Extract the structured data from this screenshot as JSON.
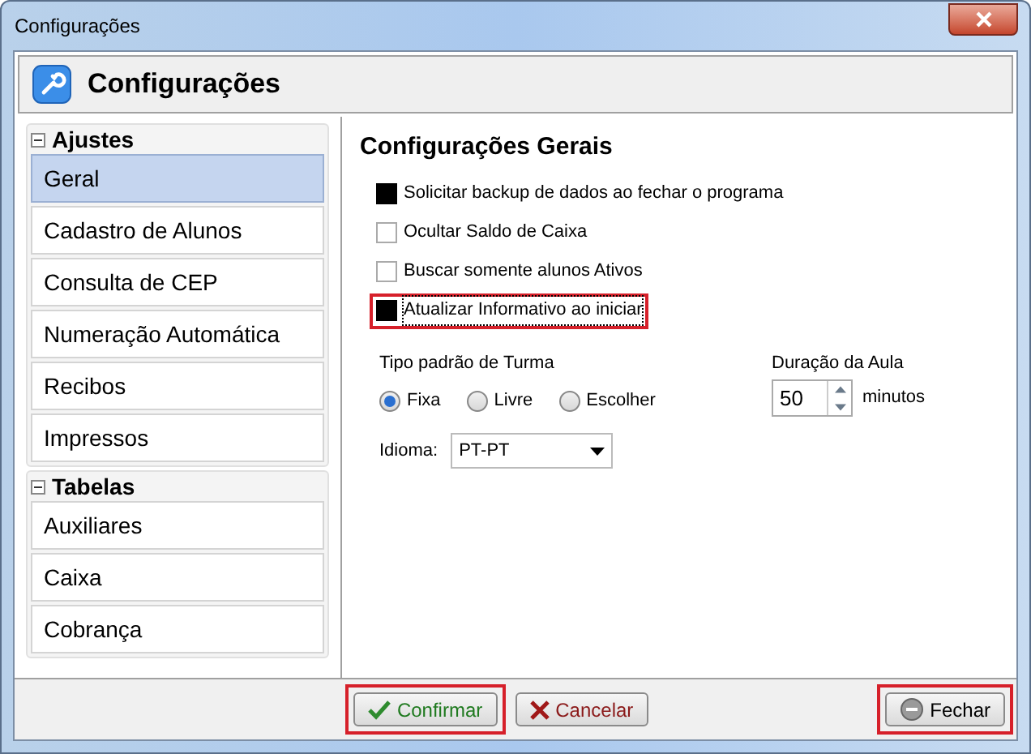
{
  "window": {
    "title": "Configurações"
  },
  "header": {
    "title": "Configurações"
  },
  "sidebar": {
    "groups": [
      {
        "label": "Ajustes",
        "expanded": true,
        "items": [
          {
            "label": "Geral",
            "selected": true
          },
          {
            "label": "Cadastro de Alunos",
            "selected": false
          },
          {
            "label": "Consulta de CEP",
            "selected": false
          },
          {
            "label": "Numeração Automática",
            "selected": false
          },
          {
            "label": "Recibos",
            "selected": false
          },
          {
            "label": "Impressos",
            "selected": false
          }
        ]
      },
      {
        "label": "Tabelas",
        "expanded": true,
        "items": [
          {
            "label": "Auxiliares",
            "selected": false
          },
          {
            "label": "Caixa",
            "selected": false
          },
          {
            "label": "Cobrança",
            "selected": false
          }
        ]
      }
    ]
  },
  "panel": {
    "title": "Configurações Gerais",
    "options": [
      {
        "label": "Solicitar backup de dados ao fechar o programa",
        "checked": true,
        "highlighted": false
      },
      {
        "label": "Ocultar Saldo de Caixa",
        "checked": false,
        "highlighted": false
      },
      {
        "label": "Buscar somente alunos Ativos",
        "checked": false,
        "highlighted": false
      },
      {
        "label": "Atualizar Informativo ao iniciar",
        "checked": true,
        "highlighted": true
      }
    ],
    "turma": {
      "label": "Tipo padrão de Turma",
      "options": [
        {
          "label": "Fixa",
          "selected": true
        },
        {
          "label": "Livre",
          "selected": false
        },
        {
          "label": "Escolher",
          "selected": false
        }
      ]
    },
    "duracao": {
      "label": "Duração da Aula",
      "value": "50",
      "unit": "minutos"
    },
    "idioma": {
      "label": "Idioma:",
      "value": "PT-PT"
    }
  },
  "buttons": [
    {
      "kind": "confirm",
      "label": "Confirmar",
      "highlighted": true
    },
    {
      "kind": "cancel",
      "label": "Cancelar",
      "highlighted": false
    },
    {
      "kind": "close",
      "label": "Fechar",
      "highlighted": true
    }
  ]
}
